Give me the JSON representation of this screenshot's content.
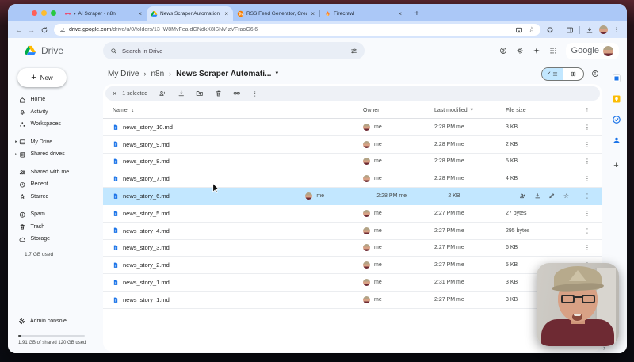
{
  "browser": {
    "tabs": [
      {
        "title": "AI Scraper - n8n",
        "icon": "n8n",
        "active": false,
        "prefix": "▸"
      },
      {
        "title": "News Scraper Automation - G",
        "icon": "drivelogo",
        "active": true,
        "prefix": ""
      },
      {
        "title": "RSS Feed Generator, Creato",
        "icon": "rss",
        "active": false,
        "prefix": ""
      },
      {
        "title": "Firecrawl",
        "icon": "flame",
        "active": false,
        "prefix": ""
      }
    ],
    "new_tab_label": "+",
    "url": "drive.google.com/drive/u/0/folders/13_W8MvFeaIdGNdkX8lSNV-zVFraoG6j6",
    "url_domain": "drive.google.com",
    "url_path": "/drive/u/0/folders/13_W8MvFeaIdGNdkX8lSNV-zVFraoG6j6"
  },
  "drive_header": {
    "app_name": "Drive",
    "search_placeholder": "Search in Drive",
    "google_label": "Google"
  },
  "breadcrumb": {
    "items": [
      "My Drive",
      "n8n"
    ],
    "current": "News Scraper Automati..."
  },
  "sidebar": {
    "new_button": "New",
    "groups": [
      [
        {
          "label": "Home",
          "icon": "home",
          "expand": false
        },
        {
          "label": "Activity",
          "icon": "bell",
          "expand": false
        },
        {
          "label": "Workspaces",
          "icon": "workspaces",
          "expand": false
        }
      ],
      [
        {
          "label": "My Drive",
          "icon": "drive",
          "expand": true
        },
        {
          "label": "Shared drives",
          "icon": "building",
          "expand": true
        }
      ],
      [
        {
          "label": "Shared with me",
          "icon": "people",
          "expand": false
        },
        {
          "label": "Recent",
          "icon": "clock",
          "expand": false
        },
        {
          "label": "Starred",
          "icon": "star",
          "expand": false
        }
      ],
      [
        {
          "label": "Spam",
          "icon": "alert",
          "expand": false
        },
        {
          "label": "Trash",
          "icon": "trash",
          "expand": false
        },
        {
          "label": "Storage",
          "icon": "cloud",
          "expand": false
        }
      ]
    ],
    "storage_used": "1.7 GB used",
    "admin_console": "Admin console",
    "storage_detail": "1.91 GB of shared 120 GB used"
  },
  "selection_toolbar": {
    "selected_label": "1 selected"
  },
  "file_table": {
    "columns": [
      "Name",
      "Owner",
      "Last modified",
      "File size"
    ],
    "rows": [
      {
        "name": "news_story_10.md",
        "owner": "me",
        "modified": "2:28 PM me",
        "size": "3 KB",
        "selected": false
      },
      {
        "name": "news_story_9.md",
        "owner": "me",
        "modified": "2:28 PM me",
        "size": "2 KB",
        "selected": false
      },
      {
        "name": "news_story_8.md",
        "owner": "me",
        "modified": "2:28 PM me",
        "size": "5 KB",
        "selected": false
      },
      {
        "name": "news_story_7.md",
        "owner": "me",
        "modified": "2:28 PM me",
        "size": "4 KB",
        "selected": false
      },
      {
        "name": "news_story_6.md",
        "owner": "me",
        "modified": "2:28 PM me",
        "size": "2 KB",
        "selected": true
      },
      {
        "name": "news_story_5.md",
        "owner": "me",
        "modified": "2:27 PM me",
        "size": "27 bytes",
        "selected": false
      },
      {
        "name": "news_story_4.md",
        "owner": "me",
        "modified": "2:27 PM me",
        "size": "295 bytes",
        "selected": false
      },
      {
        "name": "news_story_3.md",
        "owner": "me",
        "modified": "2:27 PM me",
        "size": "6 KB",
        "selected": false
      },
      {
        "name": "news_story_2.md",
        "owner": "me",
        "modified": "2:27 PM me",
        "size": "5 KB",
        "selected": false
      },
      {
        "name": "news_story_1.md",
        "owner": "me",
        "modified": "2:31 PM me",
        "size": "3 KB",
        "selected": false
      },
      {
        "name": "news_story_1.md",
        "owner": "me",
        "modified": "2:27 PM me",
        "size": "3 KB",
        "selected": false
      }
    ]
  },
  "side_panel": [
    "calendar",
    "keep",
    "tasks",
    "contacts",
    "plus"
  ],
  "colors": {
    "accent": "#1a73e8",
    "selection_row": "#c2e7ff",
    "tab_strip": "#abc8f7",
    "chrome_toolbar": "#d7e5fc",
    "drive_background": "#f8fafd",
    "doc_icon": "#1a73e8"
  }
}
